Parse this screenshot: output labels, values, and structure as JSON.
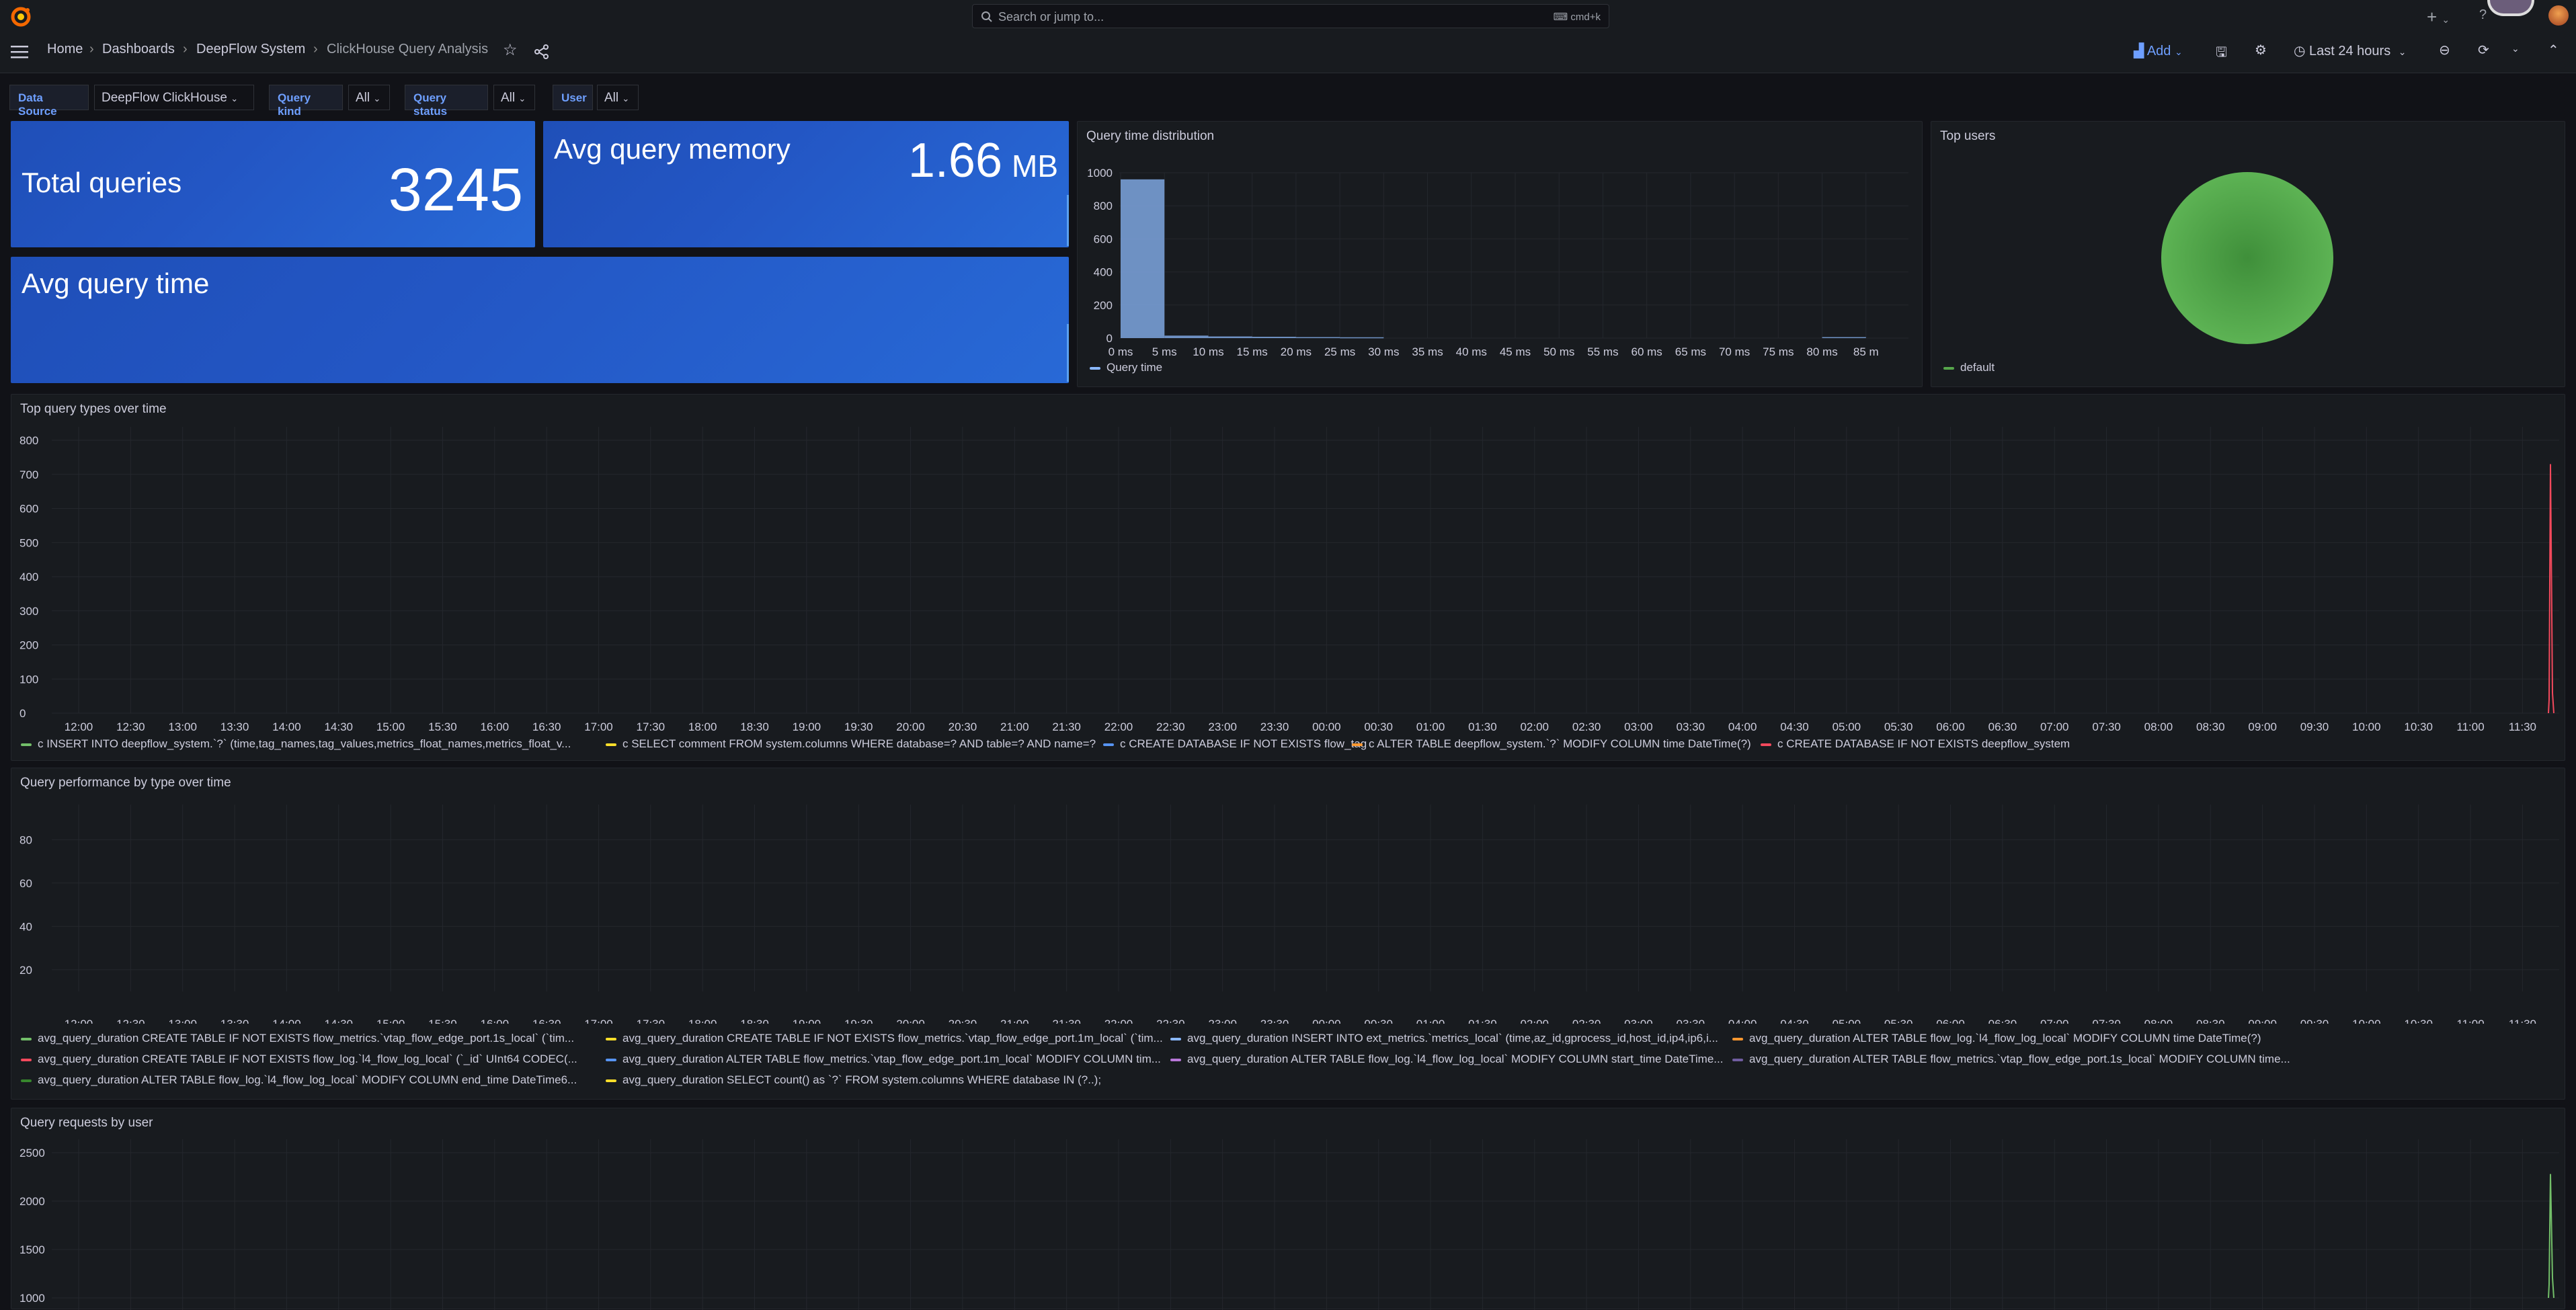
{
  "topbar": {
    "search_placeholder": "Search or jump to...",
    "search_shortcut": "cmd+k",
    "plus_label": "+"
  },
  "breadcrumbs": [
    "Home",
    "Dashboards",
    "DeepFlow System",
    "ClickHouse Query Analysis"
  ],
  "toolbar": {
    "add_label": "Add",
    "time_range": "Last 24 hours"
  },
  "variables": [
    {
      "label": "Data Source",
      "value": "DeepFlow ClickHouse"
    },
    {
      "label": "Query kind",
      "value": "All"
    },
    {
      "label": "Query status",
      "value": "All"
    },
    {
      "label": "User",
      "value": "All"
    }
  ],
  "stats": {
    "total_queries": {
      "title": "Total queries",
      "value": "3245"
    },
    "avg_memory": {
      "title": "Avg query memory",
      "value": "1.66",
      "unit": "MB"
    },
    "avg_time": {
      "title": "Avg query time"
    }
  },
  "panels": {
    "query_time_distribution": {
      "title": "Query time distribution",
      "legend": "Query time",
      "legend_color": "#8ab8ff"
    },
    "top_users": {
      "title": "Top users",
      "legend": "default",
      "legend_color": "#56a64b"
    },
    "top_query_types": {
      "title": "Top query types over time",
      "legend": [
        {
          "label": "c INSERT INTO deepflow_system.`?` (time,tag_names,tag_values,metrics_float_names,metrics_float_v...",
          "color": "#73bf69"
        },
        {
          "label": "c SELECT comment FROM system.columns WHERE database=? AND table=? AND name=?",
          "color": "#fade2a"
        },
        {
          "label": "c CREATE DATABASE IF NOT EXISTS flow_tag",
          "color": "#5794f2"
        },
        {
          "label": "c ALTER TABLE deepflow_system.`?` MODIFY COLUMN time DateTime(?)",
          "color": "#ff9830"
        },
        {
          "label": "c CREATE DATABASE IF NOT EXISTS deepflow_system",
          "color": "#f2495c"
        }
      ]
    },
    "query_performance": {
      "title": "Query performance by type over time",
      "legend": [
        {
          "label": "avg_query_duration CREATE TABLE IF NOT EXISTS flow_metrics.`vtap_flow_edge_port.1s_local` (`tim...",
          "color": "#73bf69"
        },
        {
          "label": "avg_query_duration CREATE TABLE IF NOT EXISTS flow_metrics.`vtap_flow_edge_port.1m_local` (`tim...",
          "color": "#fade2a"
        },
        {
          "label": "avg_query_duration INSERT INTO ext_metrics.`metrics_local` (time,az_id,gprocess_id,host_id,ip4,ip6,i...",
          "color": "#8ab8ff"
        },
        {
          "label": "avg_query_duration ALTER TABLE flow_log.`l4_flow_log_local` MODIFY COLUMN time DateTime(?)",
          "color": "#ff9830"
        },
        {
          "label": "avg_query_duration CREATE TABLE IF NOT EXISTS flow_log.`l4_flow_log_local` (`_id` UInt64 CODEC(...",
          "color": "#f2495c"
        },
        {
          "label": "avg_query_duration ALTER TABLE flow_metrics.`vtap_flow_edge_port.1m_local` MODIFY COLUMN tim...",
          "color": "#5794f2"
        },
        {
          "label": "avg_query_duration ALTER TABLE flow_log.`l4_flow_log_local` MODIFY COLUMN start_time DateTime...",
          "color": "#b877d9"
        },
        {
          "label": "avg_query_duration ALTER TABLE flow_metrics.`vtap_flow_edge_port.1s_local` MODIFY COLUMN time...",
          "color": "#705da0"
        },
        {
          "label": "avg_query_duration ALTER TABLE flow_log.`l4_flow_log_local` MODIFY COLUMN end_time DateTime6...",
          "color": "#37872d"
        },
        {
          "label": "avg_query_duration SELECT count() as `?` FROM system.columns WHERE database IN (?..);",
          "color": "#fade2a"
        }
      ]
    },
    "query_requests": {
      "title": "Query requests by user"
    }
  },
  "chart_data": [
    {
      "type": "bar",
      "name": "Query time distribution",
      "categories": [
        "0 ms",
        "5 ms",
        "10 ms",
        "15 ms",
        "20 ms",
        "25 ms",
        "30 ms",
        "35 ms",
        "40 ms",
        "45 ms",
        "50 ms",
        "55 ms",
        "60 ms",
        "65 ms",
        "70 ms",
        "75 ms",
        "80 ms",
        "85 m"
      ],
      "values": [
        960,
        15,
        10,
        8,
        6,
        5,
        0,
        0,
        0,
        0,
        0,
        0,
        0,
        0,
        0,
        0,
        6,
        0
      ],
      "yticks": [
        "0",
        "200",
        "400",
        "600",
        "800",
        "1000"
      ],
      "ylim": [
        0,
        1000
      ],
      "color": "#7ea6e0"
    },
    {
      "type": "pie",
      "name": "Top users",
      "labels": [
        "default"
      ],
      "values": [
        100
      ],
      "colors": [
        "#56a64b"
      ]
    },
    {
      "type": "line",
      "name": "Top query types over time",
      "x": [
        "12:00",
        "12:30",
        "13:00",
        "13:30",
        "14:00",
        "14:30",
        "15:00",
        "15:30",
        "16:00",
        "16:30",
        "17:00",
        "17:30",
        "18:00",
        "18:30",
        "19:00",
        "19:30",
        "20:00",
        "20:30",
        "21:00",
        "21:30",
        "22:00",
        "22:30",
        "23:00",
        "23:30",
        "00:00",
        "00:30",
        "01:00",
        "01:30",
        "02:00",
        "02:30",
        "03:00",
        "03:30",
        "04:00",
        "04:30",
        "05:00",
        "05:30",
        "06:00",
        "06:30",
        "07:00",
        "07:30",
        "08:00",
        "08:30",
        "09:00",
        "09:30",
        "10:00",
        "10:30",
        "11:00",
        "11:30"
      ],
      "yticks": [
        "0",
        "100",
        "200",
        "300",
        "400",
        "500",
        "600",
        "700",
        "800"
      ],
      "ylim": [
        0,
        800
      ],
      "spike": {
        "color": "#f2495c",
        "value": 730
      }
    },
    {
      "type": "line",
      "name": "Query performance by type over time",
      "x": [
        "12:00",
        "12:30",
        "13:00",
        "13:30",
        "14:00",
        "14:30",
        "15:00",
        "15:30",
        "16:00",
        "16:30",
        "17:00",
        "17:30",
        "18:00",
        "18:30",
        "19:00",
        "19:30",
        "20:00",
        "20:30",
        "21:00",
        "21:30",
        "22:00",
        "22:30",
        "23:00",
        "23:30",
        "00:00",
        "00:30",
        "01:00",
        "01:30",
        "02:00",
        "02:30",
        "03:00",
        "03:30",
        "04:00",
        "04:30",
        "05:00",
        "05:30",
        "06:00",
        "06:30",
        "07:00",
        "07:30",
        "08:00",
        "08:30",
        "09:00",
        "09:30",
        "10:00",
        "10:30",
        "11:00",
        "11:30"
      ],
      "yticks": [
        "20",
        "40",
        "60",
        "80"
      ],
      "ylim": [
        10,
        90
      ]
    },
    {
      "type": "line",
      "name": "Query requests by user",
      "yticks": [
        "1000",
        "1500",
        "2000",
        "2500"
      ],
      "ylim": [
        1000,
        2500
      ],
      "spike": {
        "color": "#73bf69",
        "value": 2280
      }
    }
  ]
}
